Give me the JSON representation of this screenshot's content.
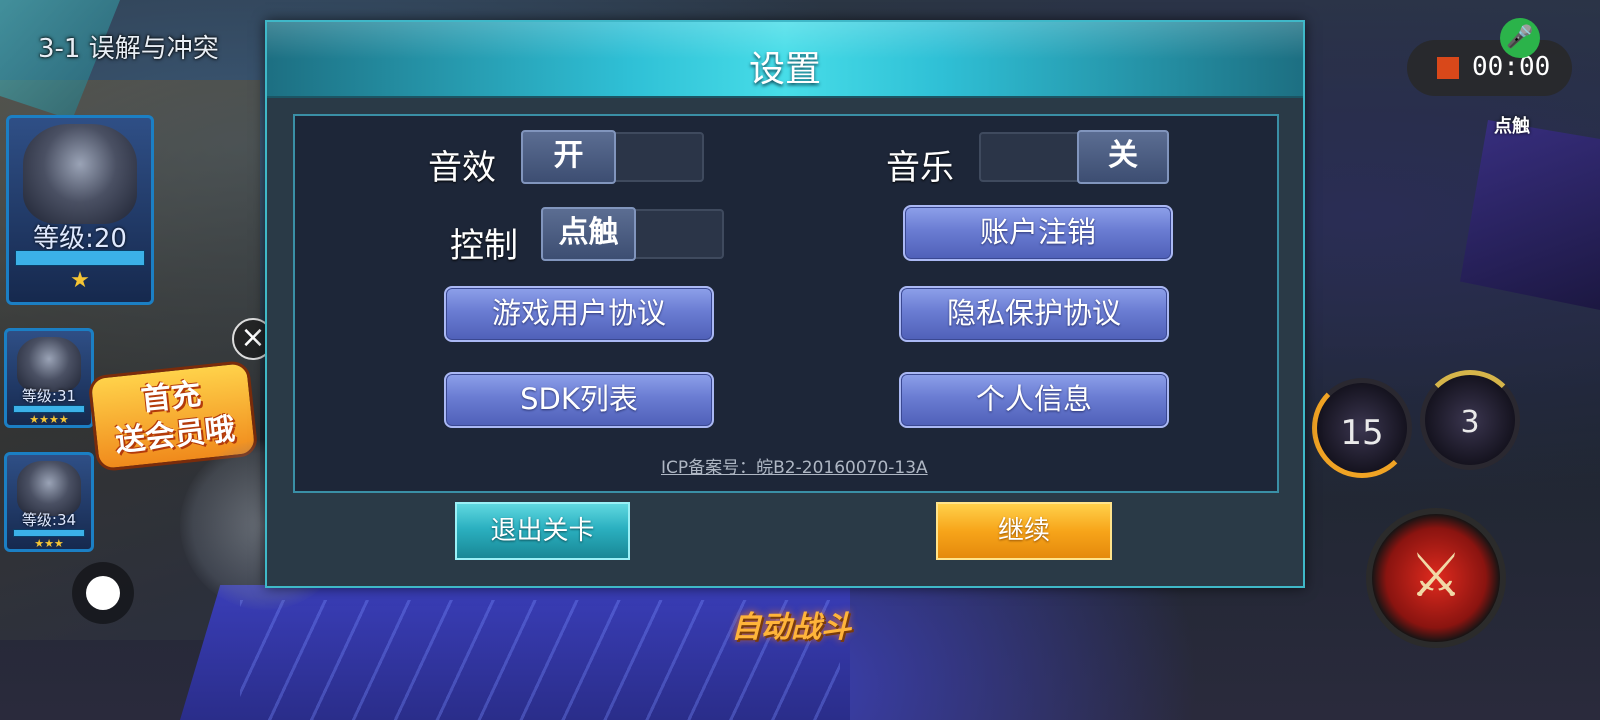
{
  "hud": {
    "stage_title": "3-1 误解与冲突",
    "heroes": [
      {
        "level": "等级:20",
        "stars": "★"
      },
      {
        "level": "等级:31",
        "stars": "★★★★"
      },
      {
        "level": "等级:34",
        "stars": "★★★"
      }
    ],
    "promo_badge": "首充\n送会员哦",
    "close_icon": "×",
    "record_time": "00:00",
    "mic_icon": "🎤",
    "touch_label": "点触",
    "skill_cooldowns": [
      "15",
      "3"
    ],
    "attack_icon": "⚔",
    "auto_battle": "自动战斗"
  },
  "settings": {
    "title": "设置",
    "sound_effects": {
      "label": "音效",
      "value": "开"
    },
    "music": {
      "label": "音乐",
      "value": "关"
    },
    "control": {
      "label": "控制",
      "value": "点触"
    },
    "buttons": {
      "account_logout": "账户注销",
      "user_agreement": "游戏用户协议",
      "privacy_agreement": "隐私保护协议",
      "sdk_list": "SDK列表",
      "personal_info": "个人信息"
    },
    "icp": "ICP备案号：皖B2-20160070-13A",
    "exit_stage": "退出关卡",
    "continue": "继续"
  },
  "colors": {
    "header_accent": "#47dde8",
    "menu_button": "#6a7cd2",
    "continue_button": "#f7a51a",
    "exit_button": "#2bb0c0",
    "record_dot": "#d9481a"
  }
}
